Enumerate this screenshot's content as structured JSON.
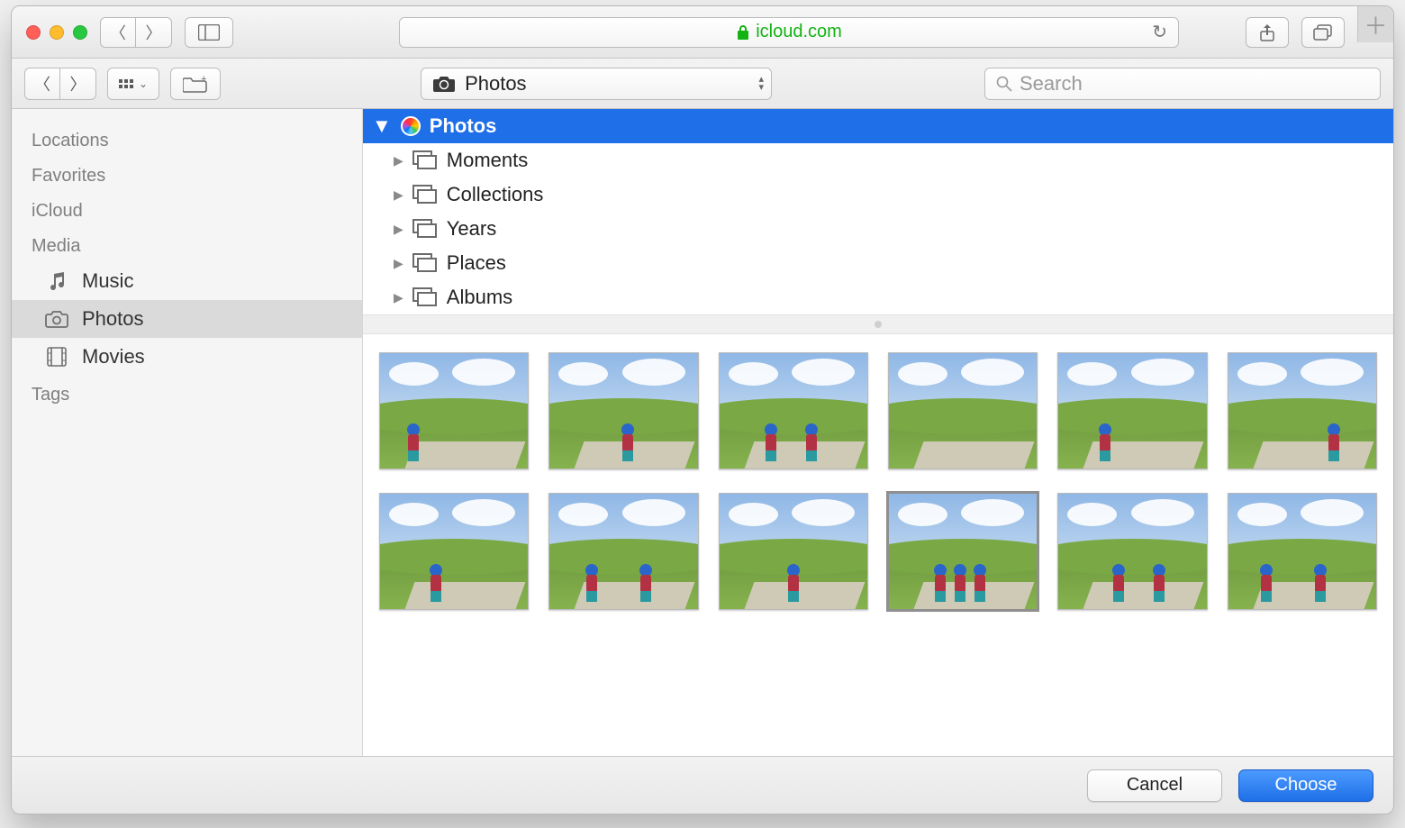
{
  "browser": {
    "url_display": "icloud.com"
  },
  "panel": {
    "location_label": "Photos",
    "search_placeholder": "Search"
  },
  "sidebar": {
    "sections": {
      "locations": "Locations",
      "favorites": "Favorites",
      "icloud": "iCloud",
      "media": "Media",
      "tags": "Tags"
    },
    "media_items": {
      "music": "Music",
      "photos": "Photos",
      "movies": "Movies"
    }
  },
  "tree": {
    "root": "Photos",
    "children": {
      "moments": "Moments",
      "collections": "Collections",
      "years": "Years",
      "places": "Places",
      "albums": "Albums"
    }
  },
  "footer": {
    "cancel": "Cancel",
    "choose": "Choose"
  }
}
